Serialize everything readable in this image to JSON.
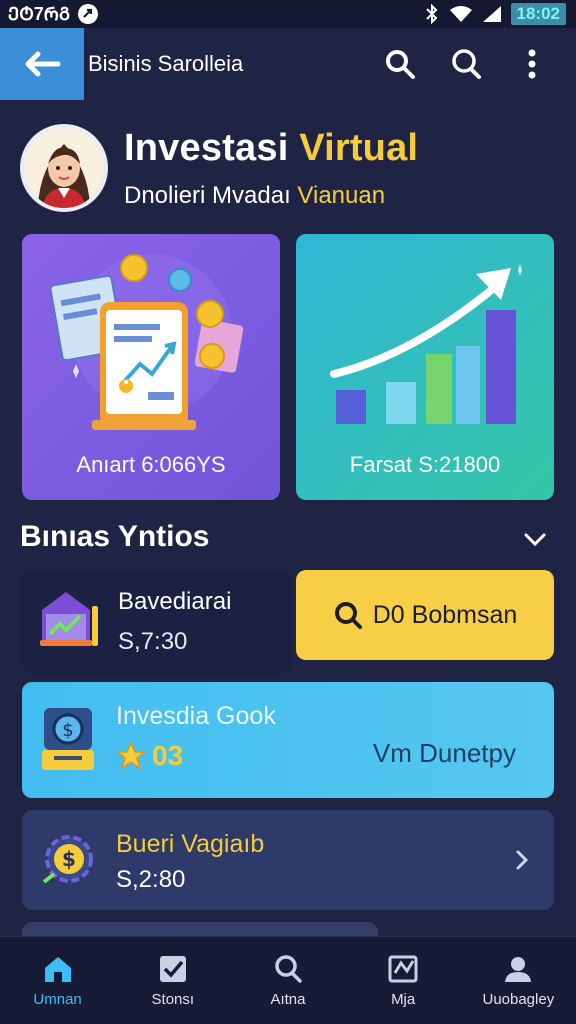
{
  "status_bar": {
    "left_text": "ᲔᲢ7ᲠᲒ",
    "time": "18:02"
  },
  "appbar": {
    "title": "Bisinis Sarolleia",
    "icons": [
      "back-arrow-icon",
      "search-icon",
      "search-icon-2",
      "more-vert-icon"
    ]
  },
  "profile": {
    "title_part1": "Investasi ",
    "title_part2": "Virtual",
    "subtitle_part1": "Dnolieri Mvadaı ",
    "subtitle_part2": "Vianuan"
  },
  "cards": {
    "left_caption": "Anıart 6:066YS",
    "right_caption": "Farsat S:21800"
  },
  "section": {
    "title": "Bınıas Yntios"
  },
  "row1": {
    "label": "Bavediarai",
    "value": "S,7:30",
    "button_label": "D0 Bobmsan"
  },
  "blue_card": {
    "label": "Invesdia Gook",
    "rating": "03",
    "right_text": "Vm Dunetpy"
  },
  "dark_card": {
    "label": "Bueri Vagiaıb",
    "value": "S,2:80"
  },
  "bottom_nav": {
    "items": [
      {
        "label": "Umnan",
        "icon": "home-icon"
      },
      {
        "label": "Stonsı",
        "icon": "checkbox-icon"
      },
      {
        "label": "Aıtna",
        "icon": "search-icon"
      },
      {
        "label": "Mja",
        "icon": "map-icon"
      },
      {
        "label": "Uuobagley",
        "icon": "profile-icon"
      }
    ],
    "active_index": 0
  },
  "colors": {
    "background": "#1f2444",
    "accent_yellow": "#f5cc3c",
    "accent_blue": "#3cbdf5",
    "card_purple": "#8a63e8",
    "card_teal": "#2fb6d6"
  }
}
